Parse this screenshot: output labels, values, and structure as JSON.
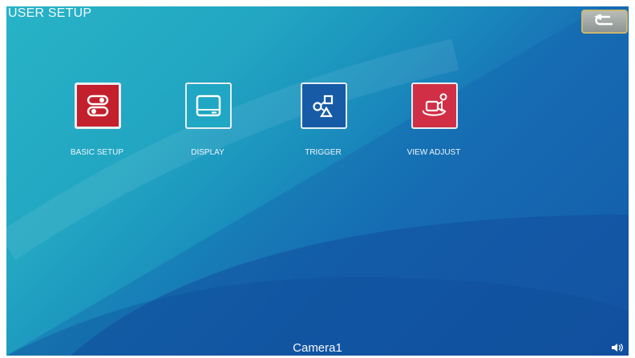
{
  "header": {
    "title": "USER SETUP",
    "back_icon": "back-arrow-icon"
  },
  "menu": {
    "items": [
      {
        "label": "BASIC SETUP",
        "icon": "toggle-switches-icon",
        "color": "#c41f2c"
      },
      {
        "label": "DISPLAY",
        "icon": "monitor-icon",
        "color": "#1fa7c4"
      },
      {
        "label": "TRIGGER",
        "icon": "shapes-icon",
        "color": "#175ba6"
      },
      {
        "label": "VIEW ADJUST",
        "icon": "camera-rotate-icon",
        "color": "#d12f45"
      }
    ]
  },
  "footer": {
    "camera_label": "Camera1",
    "volume_icon": "volume-icon"
  }
}
